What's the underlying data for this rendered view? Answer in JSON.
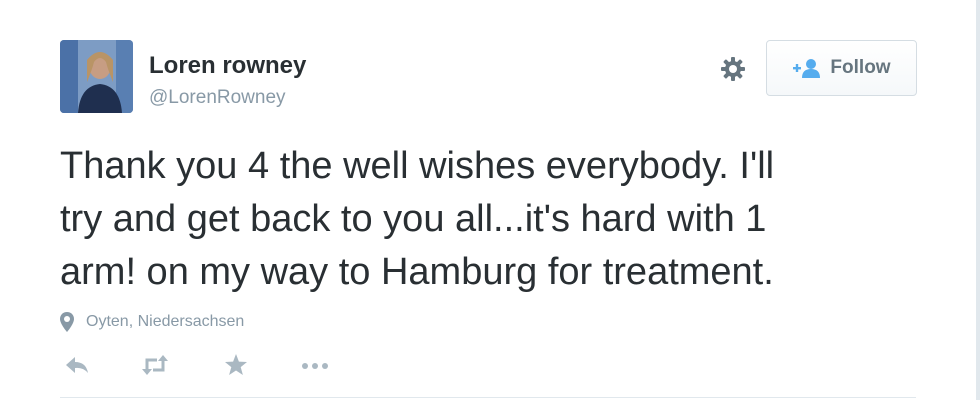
{
  "user": {
    "display_name": "Loren rowney",
    "handle": "@LorenRowney"
  },
  "follow_button": {
    "label": "Follow"
  },
  "tweet": {
    "text_lines": [
      "Thank you 4 the well wishes everybody. I'll",
      "try and get back to you all...it's hard with 1",
      "arm! on my way to Hamburg for treatment."
    ],
    "location": "Oyten, Niedersachsen"
  },
  "icons": {
    "settings": "gear-icon",
    "follow": "add-user-icon",
    "location": "map-pin-icon",
    "reply": "reply-icon",
    "retweet": "retweet-icon",
    "favorite": "star-icon",
    "more": "more-dots-icon"
  },
  "colors": {
    "text": "#292f33",
    "muted": "#8899a6",
    "follow_icon": "#55acee",
    "action_icon": "#aab8c2",
    "border": "#e1e8ed"
  }
}
